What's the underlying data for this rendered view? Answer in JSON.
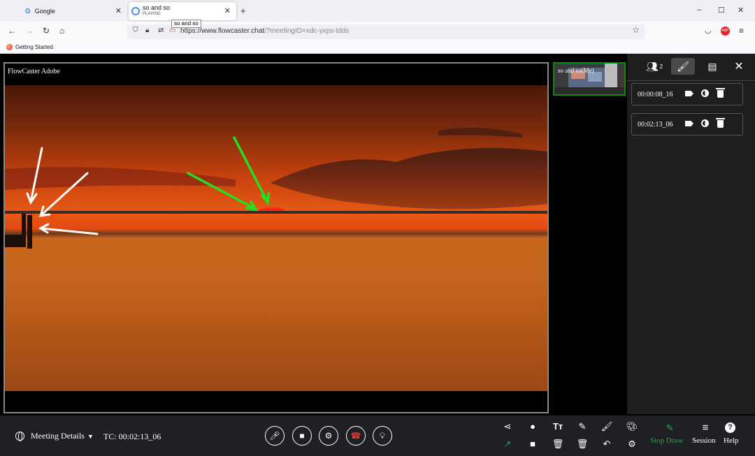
{
  "browser": {
    "tabs": [
      {
        "title": "Google"
      },
      {
        "title": "so and so",
        "subtitle": "PLAYING"
      }
    ],
    "tooltip": "so and so",
    "url_host": "https://www.flowcaster.chat",
    "url_path": "/?meetingID=xdc-yxps-tdds",
    "bookmark": "Getting Started",
    "win_controls": [
      "–",
      "☐",
      "✕"
    ]
  },
  "video": {
    "label": "FlowCaster Adobe",
    "arrows": {
      "white": 3,
      "green": 2
    },
    "colors": {
      "white_arrow": "#ffffff",
      "green_arrow": "#22e022"
    }
  },
  "participant": {
    "label": "so and so(Me)"
  },
  "side_panel": {
    "participant_count": "2",
    "markers": [
      {
        "timecode": "00:00:08_16"
      },
      {
        "timecode": "00:02:13_06"
      }
    ]
  },
  "toolbar": {
    "meeting_details": "Meeting Details",
    "timecode": "TC: 00:02:13_06",
    "stop_draw": "Stop Draw",
    "session": "Session",
    "help": "Help",
    "colors": {
      "stop_draw": "#1faa59",
      "hangup": "#e23b3b"
    }
  }
}
